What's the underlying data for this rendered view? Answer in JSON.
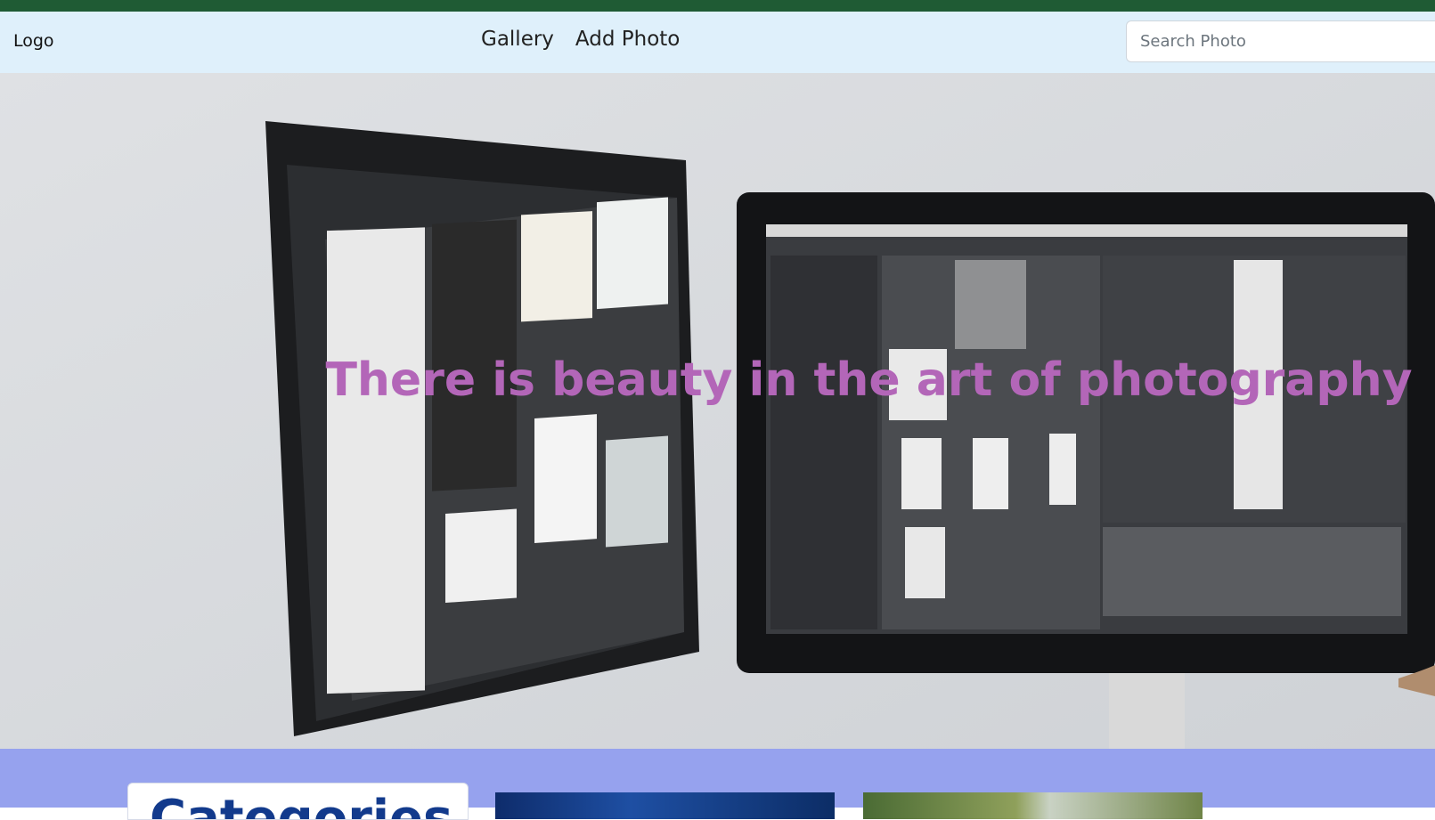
{
  "navbar": {
    "logo": "Logo",
    "links": [
      {
        "label": "Gallery"
      },
      {
        "label": "Add Photo"
      }
    ],
    "search": {
      "placeholder": "Search Photo",
      "value": ""
    }
  },
  "hero": {
    "title": "There is beauty in the art of photography"
  },
  "categories": {
    "heading": "Categories"
  },
  "colors": {
    "topbar": "#1f5b34",
    "navbar_bg": "#dff0fb",
    "hero_title": "#b366b8",
    "section_bg": "#96a2ee",
    "heading": "#123a8c"
  }
}
